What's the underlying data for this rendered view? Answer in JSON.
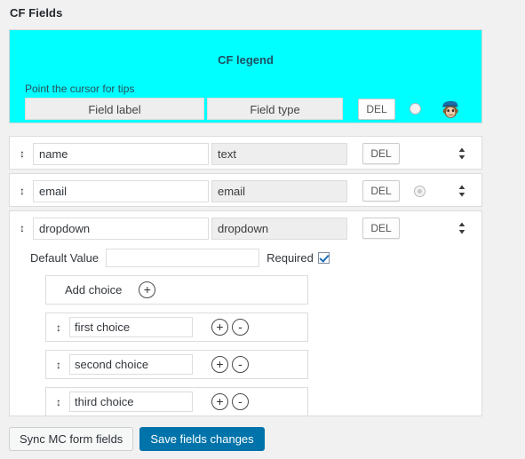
{
  "page": {
    "title": "CF Fields"
  },
  "legend": {
    "title": "CF legend",
    "tip": "Point the cursor for tips",
    "col_label": "Field label",
    "col_type": "Field type",
    "del_label": "DEL",
    "radio_icon": "radio-button",
    "mailchimp_icon": "mailchimp-freddie-icon",
    "bg_color": "#00FFFF",
    "title_color": "#1C4F63"
  },
  "fields": [
    {
      "handle_icon": "drag-handle-icon",
      "label": "name",
      "type": "text",
      "del_label": "DEL",
      "has_radio": false,
      "sorter_icon": "sort-updown-icon"
    },
    {
      "handle_icon": "drag-handle-icon",
      "label": "email",
      "type": "email",
      "del_label": "DEL",
      "has_radio": true,
      "radio_checked": true,
      "sorter_icon": "sort-updown-icon"
    },
    {
      "handle_icon": "drag-handle-icon",
      "label": "dropdown",
      "type": "dropdown",
      "del_label": "DEL",
      "has_radio": false,
      "sorter_icon": "sort-updown-icon",
      "default_value_label": "Default Value",
      "default_value": "",
      "required_label": "Required",
      "required_checked": true,
      "add_choice_label": "Add choice",
      "add_choice_icon": "plus-circle-icon",
      "choices": [
        {
          "handle_icon": "drag-handle-icon",
          "value": "first choice",
          "plus_icon": "plus-circle-icon",
          "minus_icon": "minus-circle-icon"
        },
        {
          "handle_icon": "drag-handle-icon",
          "value": "second choice",
          "plus_icon": "plus-circle-icon",
          "minus_icon": "minus-circle-icon"
        },
        {
          "handle_icon": "drag-handle-icon",
          "value": "third choice",
          "plus_icon": "plus-circle-icon",
          "minus_icon": "minus-circle-icon"
        }
      ]
    }
  ],
  "footer": {
    "sync_label": "Sync MC form fields",
    "save_label": "Save fields changes",
    "primary_color": "#0073AA"
  },
  "glyphs": {
    "drag": "↕",
    "plus": "+",
    "minus": "-"
  }
}
